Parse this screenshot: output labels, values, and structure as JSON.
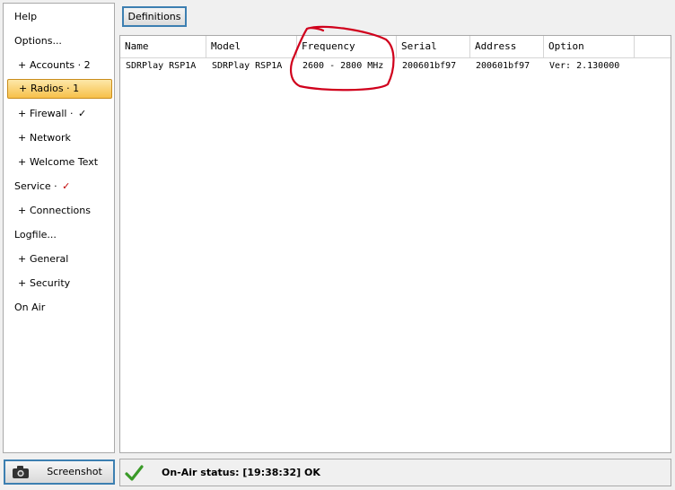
{
  "sidebar": {
    "items": [
      {
        "label": "Help",
        "sub": false
      },
      {
        "label": "Options...",
        "sub": false
      },
      {
        "label": "Accounts · 2",
        "sub": true
      },
      {
        "label": "Radios · 1",
        "sub": true,
        "selected": true
      },
      {
        "label": "Firewall · ",
        "sub": true,
        "check": "✓"
      },
      {
        "label": "Network",
        "sub": true
      },
      {
        "label": "Welcome Text",
        "sub": true
      },
      {
        "label": "Service · ",
        "sub": false,
        "check": "✓",
        "check_color": "red"
      },
      {
        "label": "Connections",
        "sub": true
      },
      {
        "label": "Logfile...",
        "sub": false
      },
      {
        "label": "General",
        "sub": true
      },
      {
        "label": "Security",
        "sub": true
      },
      {
        "label": "On Air",
        "sub": false
      }
    ],
    "plus_glyph": "+"
  },
  "toolbar": {
    "definitions_label": "Definitions"
  },
  "table": {
    "columns": [
      "Name",
      "Model",
      "Frequency",
      "Serial",
      "Address",
      "Option"
    ],
    "rows": [
      [
        "SDRPlay RSP1A",
        "SDRPlay RSP1A",
        "2600 - 2800 MHz",
        "200601bf97",
        "200601bf97",
        "Ver: 2.130000"
      ]
    ]
  },
  "footer": {
    "screenshot_label": "Screenshot",
    "screenshot_icon": "camera-icon",
    "status_icon": "checkmark-icon",
    "status_text": "On-Air status: [19:38:32] OK"
  },
  "colors": {
    "accent": "#3c7fb1",
    "selected_bg": "#f7c04a",
    "annotation": "#d0001c",
    "ok_green": "#3a9a28"
  }
}
